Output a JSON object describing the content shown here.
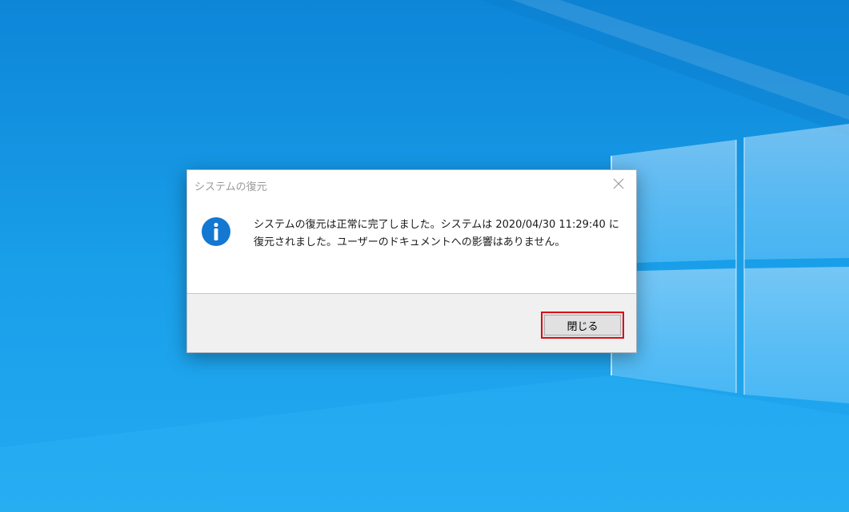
{
  "dialog": {
    "title": "システムの復元",
    "message_line1": "システムの復元は正常に完了しました。システムは 2020/04/30 11:29:40 に",
    "message_line2": "復元されました。ユーザーのドキュメントへの影響はありません。",
    "close_button_label": "閉じる",
    "icon": "info-icon"
  },
  "colors": {
    "desktop_background": "#1aa0ea",
    "highlight_border": "#d90f17",
    "info_icon": "#1378d1"
  }
}
